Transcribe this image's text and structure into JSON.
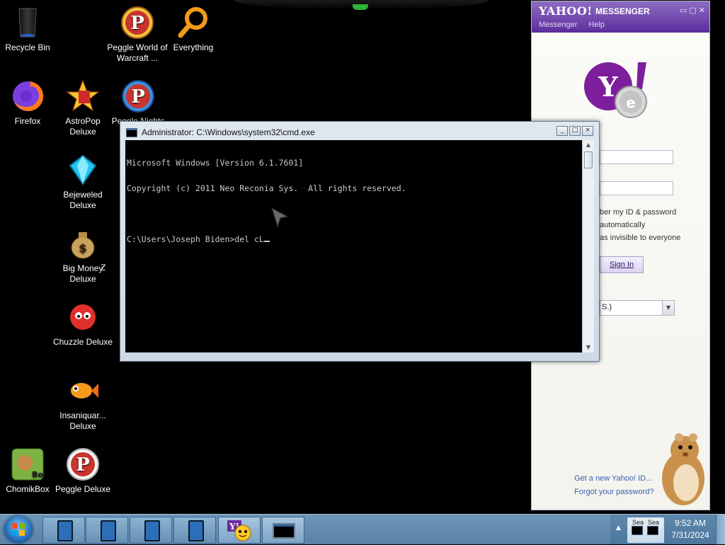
{
  "desktop": {
    "icons": [
      {
        "label": "Recycle Bin",
        "icon": "recycle-bin-icon"
      },
      {
        "label": "Peggle World of Warcraft ...",
        "icon": "peggle-icon"
      },
      {
        "label": "Everything",
        "icon": "search-icon"
      },
      {
        "label": "Firefox",
        "icon": "firefox-icon"
      },
      {
        "label": "AstroPop Deluxe",
        "icon": "astropop-icon"
      },
      {
        "label": "Peggle Nights",
        "icon": "peggle-icon"
      },
      {
        "label": "Bejeweled Deluxe",
        "icon": "gem-icon"
      },
      {
        "label": "Big Money Deluxe",
        "icon": "money-bag-icon"
      },
      {
        "label": "Chuzzle Deluxe",
        "icon": "chuzzle-icon"
      },
      {
        "label": "Insaniquar... Deluxe",
        "icon": "fish-icon"
      },
      {
        "label": "ChomikBox",
        "icon": "chomikbox-icon"
      },
      {
        "label": "Peggle Deluxe",
        "icon": "peggle-icon"
      }
    ],
    "partial_label": "Z"
  },
  "cmd": {
    "title": "Administrator: C:\\Windows\\system32\\cmd.exe",
    "lines": [
      "Microsoft Windows [Version 6.1.7601]",
      "Copyright (c) 2011 Neo Reconia Sys.  All rights reserved.",
      "",
      "C:\\Users\\Joseph Biden>del cL"
    ],
    "buttons": {
      "minimize": "_",
      "maximize": "□",
      "close": "×"
    }
  },
  "messenger": {
    "logo": "YAHOO!",
    "title": "MESSENGER",
    "menu": [
      "Messenger",
      "Help"
    ],
    "options": [
      "ber my ID & password",
      "automatically",
      "as invisible to everyone"
    ],
    "sign_in": "Sign In",
    "select_value": "S.)",
    "links": [
      "Get a new Yahoo! ID...",
      "Forgot your password?"
    ],
    "colors": {
      "purple": "#5d2f9e",
      "link": "#3a5fb3"
    }
  },
  "taskbar": {
    "clock_time": "9:52 AM",
    "clock_date": "7/31/2024",
    "tray_labels": [
      "Sea",
      "Sea"
    ]
  }
}
